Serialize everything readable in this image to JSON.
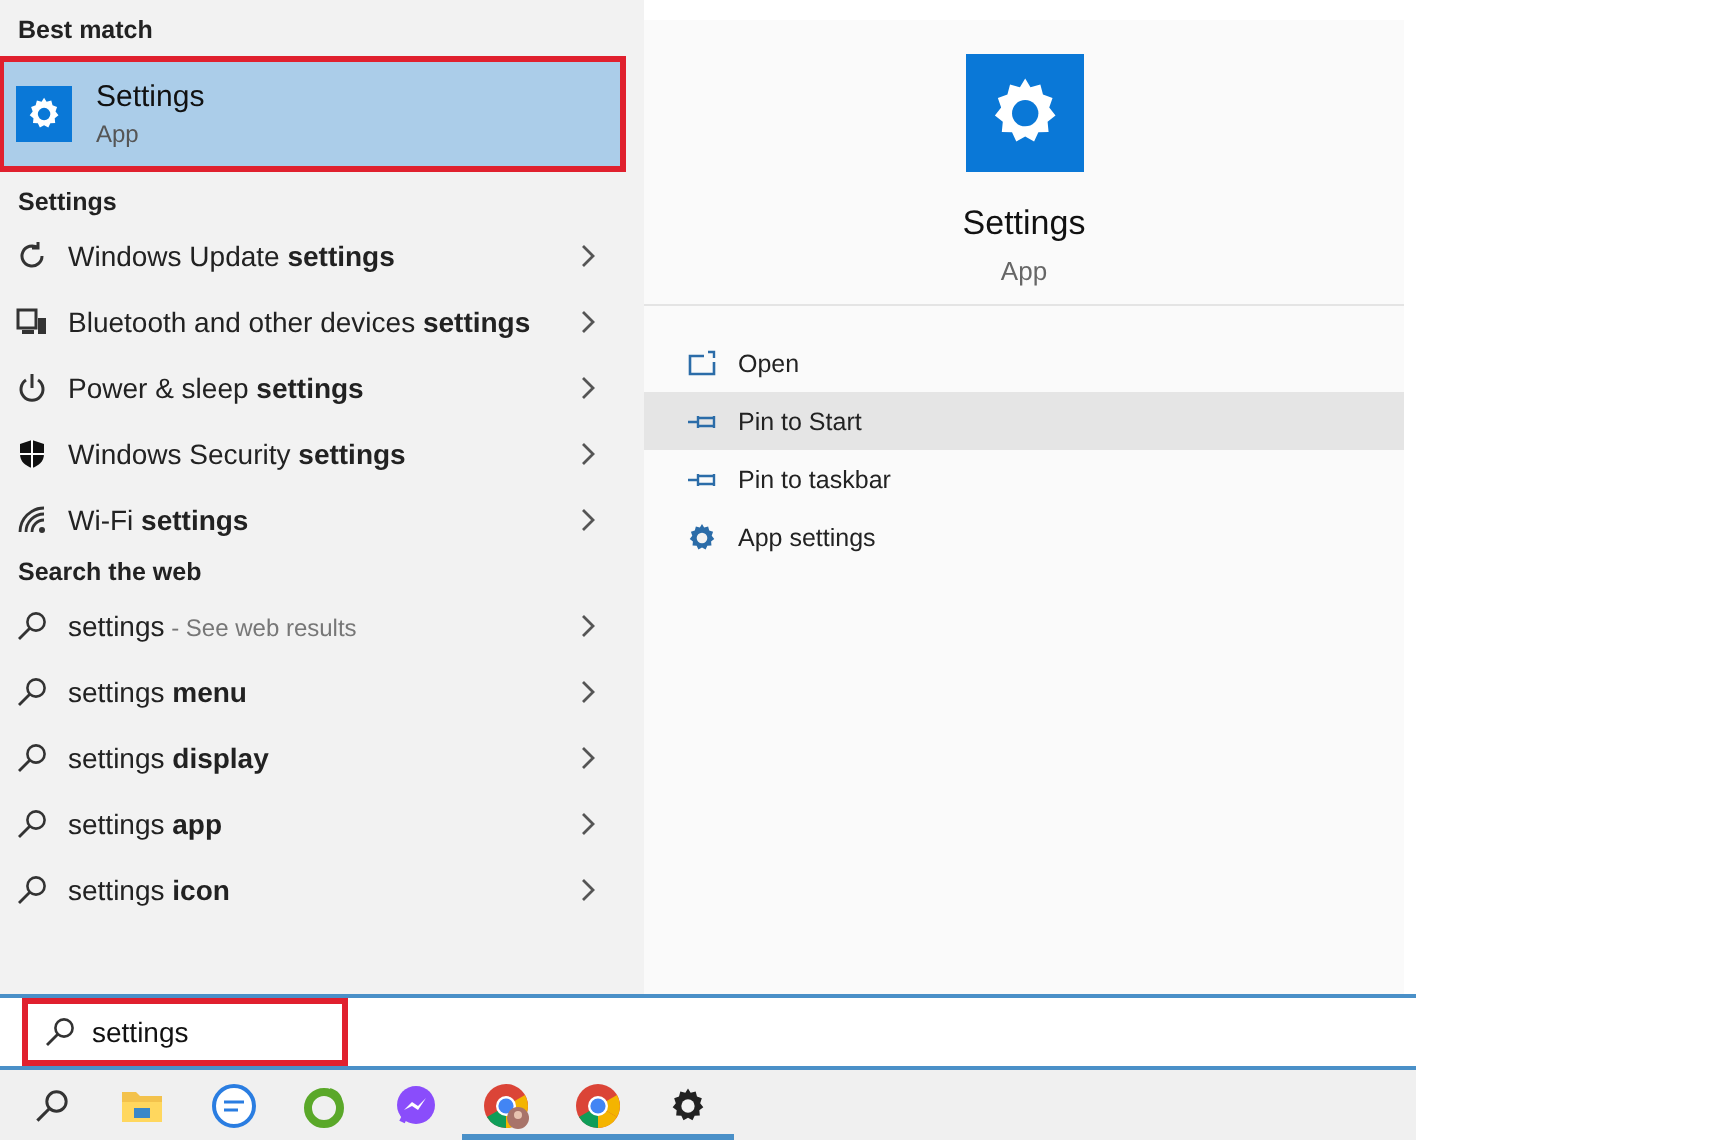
{
  "best_match": {
    "heading": "Best match",
    "title": "Settings",
    "subtitle": "App",
    "selected": true,
    "highlighted": true
  },
  "settings_group": {
    "heading": "Settings",
    "items": [
      {
        "label": "Windows Update **settings**",
        "kind": "update"
      },
      {
        "label": "Bluetooth and other devices **settings**",
        "kind": "devices"
      },
      {
        "label": "Power & sleep **settings**",
        "kind": "power"
      },
      {
        "label": "Windows Security **settings**",
        "kind": "shield"
      },
      {
        "label": "Wi-Fi **settings**",
        "kind": "wifi"
      }
    ]
  },
  "web_group": {
    "heading": "Search the web",
    "items": [
      {
        "label": "settings",
        "suffix": " - See web results"
      },
      {
        "label": "settings **menu**"
      },
      {
        "label": "settings **display**"
      },
      {
        "label": "settings **app**"
      },
      {
        "label": "settings **icon**"
      }
    ]
  },
  "preview": {
    "title": "Settings",
    "subtitle": "App",
    "actions": [
      {
        "label": "Open",
        "kind": "open",
        "selected": false
      },
      {
        "label": "Pin to Start",
        "kind": "pin",
        "selected": true
      },
      {
        "label": "Pin to taskbar",
        "kind": "pin",
        "selected": false
      },
      {
        "label": "App settings",
        "kind": "gear",
        "selected": false
      }
    ]
  },
  "search": {
    "value": "settings",
    "highlighted": true
  },
  "taskbar": [
    {
      "kind": "search",
      "running": false
    },
    {
      "kind": "folder",
      "running": false
    },
    {
      "kind": "zalo",
      "running": false
    },
    {
      "kind": "coccoc",
      "running": false
    },
    {
      "kind": "messenger",
      "running": false
    },
    {
      "kind": "chrome-profile",
      "running": true
    },
    {
      "kind": "chrome",
      "running": true
    },
    {
      "kind": "gear",
      "running": true
    }
  ]
}
